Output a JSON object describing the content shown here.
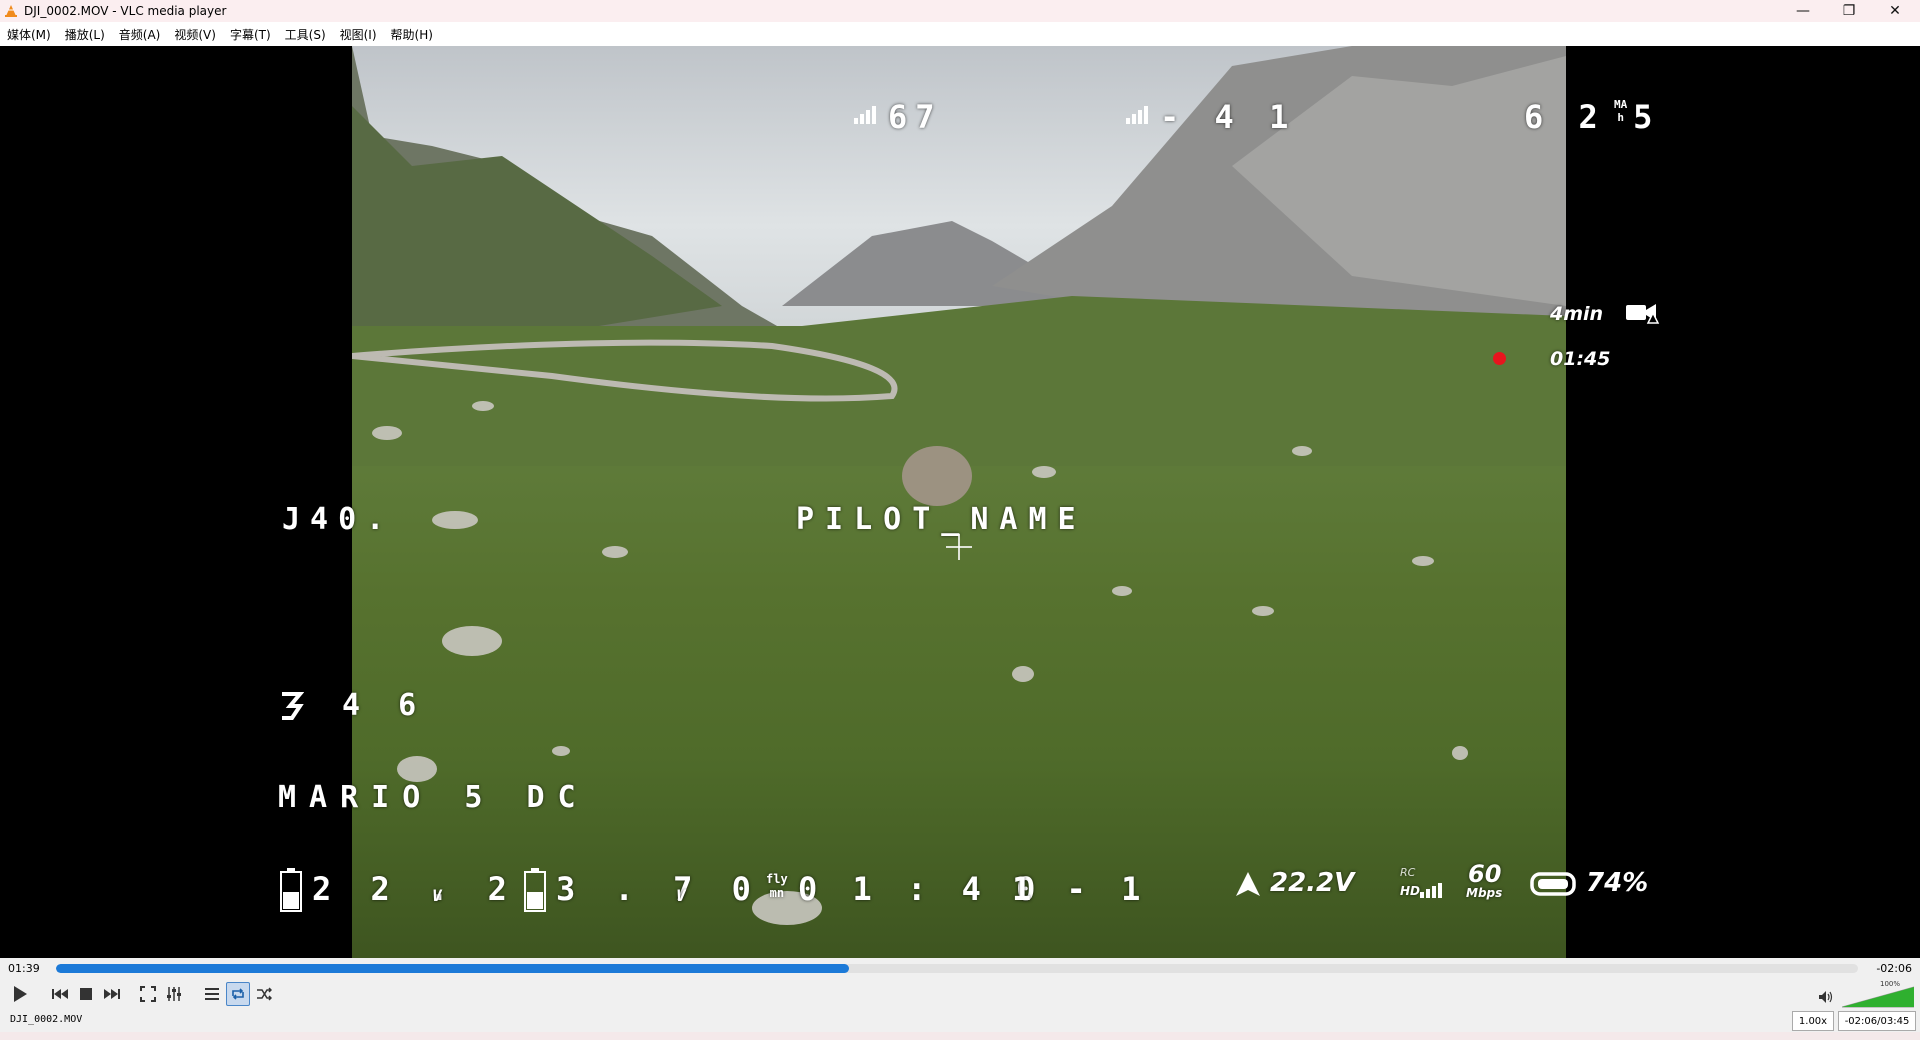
{
  "window": {
    "title": "DJI_0002.MOV - VLC media player"
  },
  "menu": [
    "媒体(M)",
    "播放(L)",
    "音频(A)",
    "视频(V)",
    "字幕(T)",
    "工具(S)",
    "视图(I)",
    "帮助(H)"
  ],
  "osd": {
    "signal_left": "67",
    "signal_right": "- 4 1",
    "mah": "6 2 5",
    "mah_unit_top": "MA",
    "mah_unit_bottom": "h",
    "rec_time_label": "4min",
    "rec_elapsed": "01:45",
    "craft_id": "J40.",
    "pilot_name": "PILOT_NAME",
    "heading_value": "4 6",
    "craft_name": "MARIO 5 DC",
    "battery_voltage": "2 2 . 2",
    "battery_voltage_unit": "V",
    "cell_voltage": "3 . 7 0",
    "cell_voltage_unit": "V",
    "fly_label_top": "fly",
    "fly_label_bottom": "mn",
    "fly_time": "0 1 : 4 0",
    "channel": "1 - 1",
    "goggle_voltage": "22.2V",
    "rc_label": "RC",
    "hd_label": "HD",
    "bitrate": "60",
    "bitrate_unit": "Mbps",
    "goggle_battery": "74%"
  },
  "player": {
    "elapsed": "01:39",
    "remaining": "-02:06",
    "progress": 0.44,
    "volume_percent_label": "100%",
    "volume": 1.0
  },
  "status": {
    "filename": "DJI_0002.MOV",
    "rate": "1.00x",
    "time": "-02:06/03:45"
  },
  "colors": {
    "seek": "#1c7ad8",
    "rec_dot": "#e8141e",
    "volume": "#2fb02f"
  }
}
